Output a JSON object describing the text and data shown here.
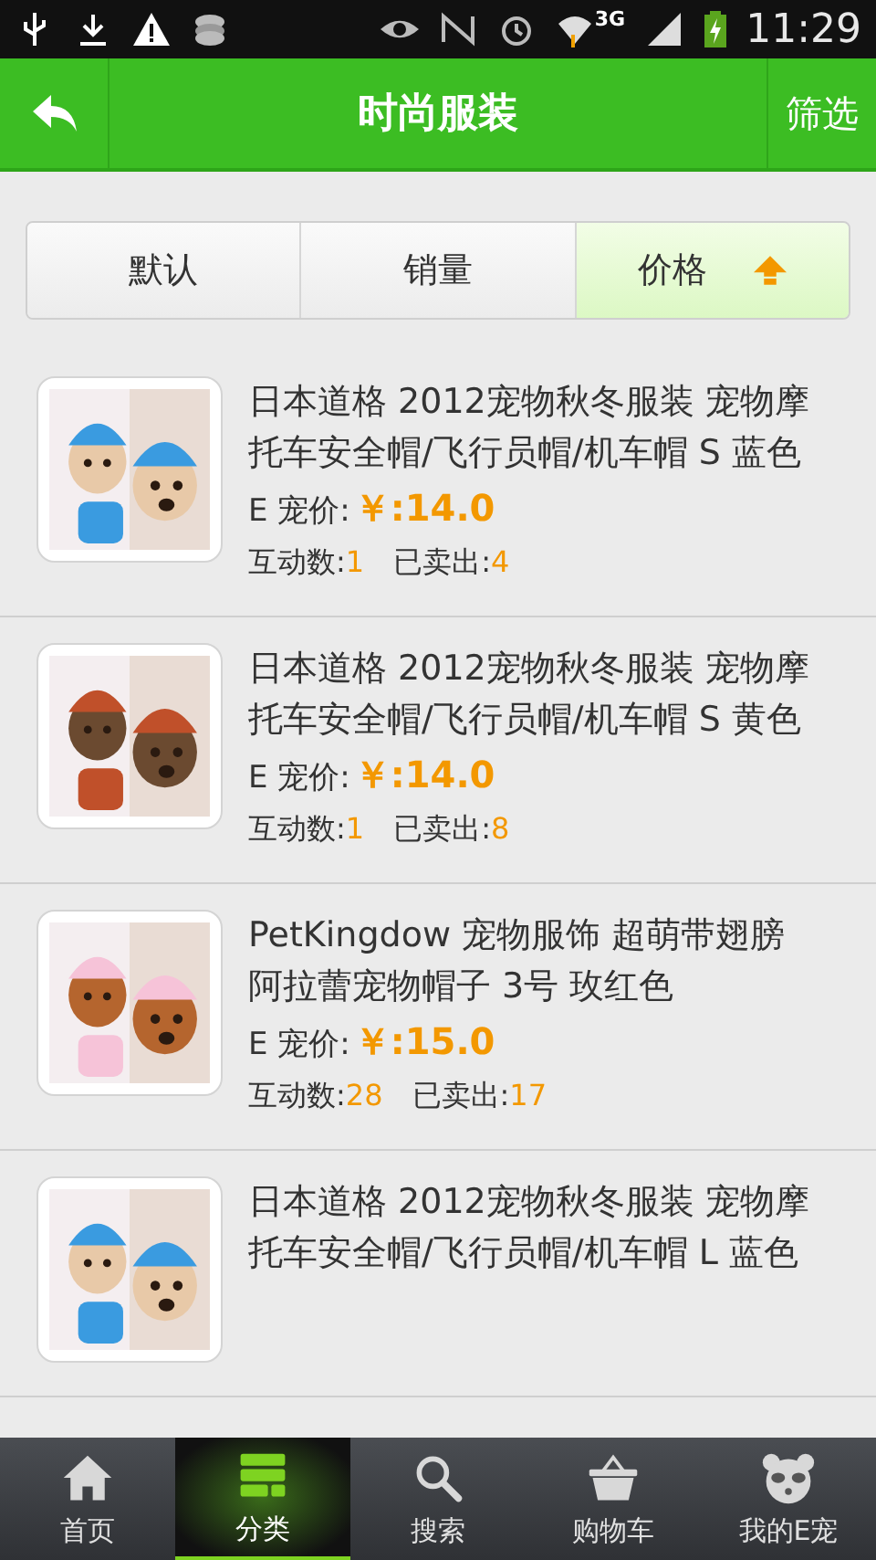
{
  "status_bar": {
    "network": "3G",
    "time": "11:29"
  },
  "header": {
    "title": "时尚服装",
    "action": "筛选"
  },
  "sort_tabs": [
    {
      "label": "默认",
      "selected": false,
      "sort_ascending": false
    },
    {
      "label": "销量",
      "selected": false,
      "sort_ascending": false
    },
    {
      "label": "价格",
      "selected": true,
      "sort_ascending": true
    }
  ],
  "products": [
    {
      "title": "日本道格 2012宠物秋冬服装 宠物摩托车安全帽/飞行员帽/机车帽 S 蓝色",
      "price_label": "E 宠价:",
      "price": "￥:14.0",
      "interactions_label": "互动数:",
      "interactions": "1",
      "sold_label": "已卖出:",
      "sold": "4"
    },
    {
      "title": "日本道格 2012宠物秋冬服装 宠物摩托车安全帽/飞行员帽/机车帽 S 黄色",
      "price_label": "E 宠价:",
      "price": "￥:14.0",
      "interactions_label": "互动数:",
      "interactions": "1",
      "sold_label": "已卖出:",
      "sold": "8"
    },
    {
      "title": "PetKingdow 宠物服饰 超萌带翅膀阿拉蕾宠物帽子 3号 玫红色",
      "price_label": "E 宠价:",
      "price": "￥:15.0",
      "interactions_label": "互动数:",
      "interactions": "28",
      "sold_label": "已卖出:",
      "sold": "17"
    },
    {
      "title": "日本道格 2012宠物秋冬服装 宠物摩托车安全帽/飞行员帽/机车帽 L 蓝色"
    }
  ],
  "tab_bar": [
    {
      "label": "首页",
      "selected": false
    },
    {
      "label": "分类",
      "selected": true
    },
    {
      "label": "搜索",
      "selected": false
    },
    {
      "label": "购物车",
      "selected": false
    },
    {
      "label": "我的E宠",
      "selected": false
    }
  ]
}
